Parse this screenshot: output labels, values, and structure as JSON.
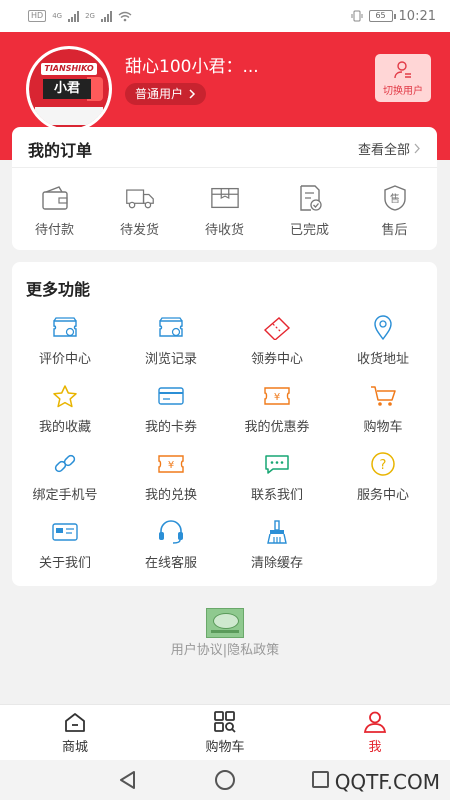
{
  "status_bar": {
    "badge": "HD",
    "network_1": "4G",
    "network_2": "2G",
    "battery": "65",
    "time": "10:21"
  },
  "header": {
    "avatar": {
      "brand_text": "TIANSHIKO",
      "name": "小君"
    },
    "user_name": "甜心100小君：...",
    "user_level": "普通用户",
    "switch_user_label": "切换用户"
  },
  "orders": {
    "title": "我的订单",
    "view_all": "查看全部",
    "items": [
      {
        "label": "待付款",
        "icon": "wallet-icon"
      },
      {
        "label": "待发货",
        "icon": "truck-icon"
      },
      {
        "label": "待收货",
        "icon": "box-icon"
      },
      {
        "label": "已完成",
        "icon": "check-document-icon"
      },
      {
        "label": "售后",
        "icon": "after-sales-icon"
      }
    ]
  },
  "more": {
    "title": "更多功能",
    "items": [
      {
        "label": "评价中心",
        "icon": "review-icon",
        "color": "#2b8fd6"
      },
      {
        "label": "浏览记录",
        "icon": "history-icon",
        "color": "#2b8fd6"
      },
      {
        "label": "领券中心",
        "icon": "coupon-center-icon",
        "color": "#e5262f"
      },
      {
        "label": "收货地址",
        "icon": "location-icon",
        "color": "#2b8fd6"
      },
      {
        "label": "我的收藏",
        "icon": "star-icon",
        "color": "#e8b400"
      },
      {
        "label": "我的卡券",
        "icon": "card-icon",
        "color": "#2b8fd6"
      },
      {
        "label": "我的优惠券",
        "icon": "yen-coupon-icon",
        "color": "#f07a1a"
      },
      {
        "label": "购物车",
        "icon": "cart-icon",
        "color": "#f07a1a"
      },
      {
        "label": "绑定手机号",
        "icon": "link-icon",
        "color": "#2b8fd6"
      },
      {
        "label": "我的兑换",
        "icon": "exchange-icon",
        "color": "#f07a1a"
      },
      {
        "label": "联系我们",
        "icon": "chat-icon",
        "color": "#17a673"
      },
      {
        "label": "服务中心",
        "icon": "help-icon",
        "color": "#e8b400"
      },
      {
        "label": "关于我们",
        "icon": "about-card-icon",
        "color": "#2b8fd6"
      },
      {
        "label": "在线客服",
        "icon": "headset-icon",
        "color": "#2b8fd6"
      },
      {
        "label": "清除缓存",
        "icon": "broom-icon",
        "color": "#2b8fd6"
      }
    ]
  },
  "footer": {
    "policy": "用户协议|隐私政策"
  },
  "tabbar": {
    "items": [
      {
        "label": "商城",
        "icon": "home-icon",
        "active": false
      },
      {
        "label": "购物车",
        "icon": "grid-search-icon",
        "active": false
      },
      {
        "label": "我",
        "icon": "user-icon",
        "active": true
      }
    ]
  },
  "watermark": "QQTF.COM",
  "colors": {
    "brand_red": "#ee2d3b",
    "active_tab": "#e5262f"
  }
}
